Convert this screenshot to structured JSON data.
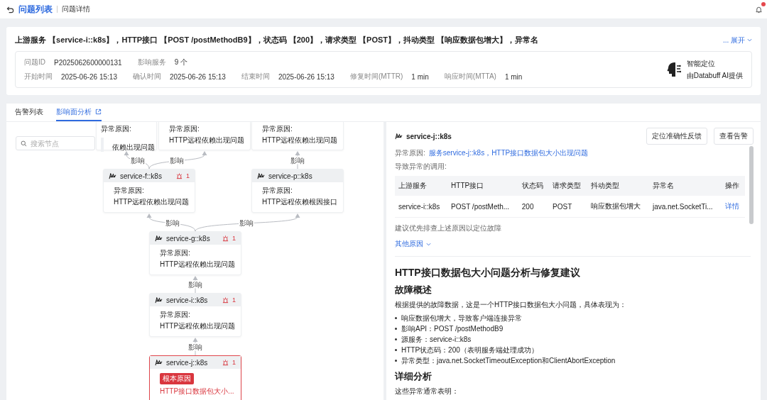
{
  "breadcrumb": {
    "parent": "问题列表",
    "current": "问题详情"
  },
  "notifications": {
    "unread": true
  },
  "issue": {
    "title": "上游服务 【service-i::k8s】，HTTP接口 【POST /postMethodB9】，状态码 【200】，请求类型 【POST】，抖动类型 【响应数据包增大】，异常名",
    "ellipsis": "...",
    "expand": "展开",
    "field_rows": [
      [
        {
          "label": "问题ID",
          "value": "P2025062600000131"
        },
        {
          "label": "影响服务",
          "value": "9 个"
        }
      ],
      [
        {
          "label": "开始时间",
          "value": "2025-06-26 15:13"
        },
        {
          "label": "确认时间",
          "value": "2025-06-26 15:13"
        },
        {
          "label": "结束时间",
          "value": "2025-06-26 15:13"
        },
        {
          "label": "修复时间(MTTR)",
          "value": "1 min"
        },
        {
          "label": "响应时间(MTTA)",
          "value": "1 min"
        }
      ]
    ],
    "ai": {
      "title": "智能定位",
      "subtitle": "由Databuff AI提供"
    }
  },
  "tabs": [
    {
      "label": "告警列表",
      "selected": false,
      "icon": false
    },
    {
      "label": "影响面分析",
      "selected": true,
      "icon": true
    }
  ],
  "graph": {
    "search_placeholder": "搜索节点",
    "nodes": [
      {
        "kind": "covered",
        "reason_label": "异常原因:",
        "reason": "依赖出现问题"
      },
      {
        "kind": "partial",
        "reason_label": "异常原因:",
        "reason": "HTTP远程依赖出现问题"
      },
      {
        "kind": "partial",
        "reason_label": "异常原因:",
        "reason": "HTTP远程依赖出现问题"
      },
      {
        "kind": "service",
        "name": "service-f::k8s",
        "alerts": "1",
        "reason_label": "异常原因:",
        "reason": "HTTP远程依赖出现问题"
      },
      {
        "kind": "service",
        "name": "service-p::k8s",
        "reason_label": "异常原因:",
        "reason": "HTTP远程依赖根因接口"
      },
      {
        "kind": "service",
        "name": "service-g::k8s",
        "alerts": "1",
        "reason_label": "异常原因:",
        "reason": "HTTP远程依赖出现问题"
      },
      {
        "kind": "service",
        "name": "service-i::k8s",
        "alerts": "1",
        "reason_label": "异常原因:",
        "reason": "HTTP远程依赖出现问题"
      },
      {
        "kind": "root",
        "name": "service-j::k8s",
        "alerts": "1",
        "badge": "根本原因",
        "reason": "HTTP接口数据包大小..."
      }
    ],
    "edges": [
      {
        "label": "影响"
      },
      {
        "label": "影响"
      },
      {
        "label": "影响"
      },
      {
        "label": "影响"
      },
      {
        "label": "影响"
      },
      {
        "label": "影响"
      },
      {
        "label": "影响"
      }
    ]
  },
  "detail": {
    "service": "service-j::k8s",
    "buttons": [
      "定位准确性反馈",
      "查看告警"
    ],
    "reason_label": "异常原因:",
    "reason": "服务service-j::k8s，HTTP接口数据包大小出现问题",
    "calls_label": "导致异常的调用:",
    "table": {
      "columns": [
        "上游服务",
        "HTTP接口",
        "状态码",
        "请求类型",
        "抖动类型",
        "异常名",
        "操作"
      ],
      "rows": [
        {
          "cells": [
            "service-i::k8s",
            "POST /postMeth...",
            "200",
            "POST",
            "响应数据包增大",
            "java.net.SocketTi..."
          ],
          "action": "详情"
        }
      ]
    },
    "hint": "建议优先排查上述原因以定位故障",
    "other": "其他原因"
  },
  "report": {
    "title": "HTTP接口数据包大小问题分析与修复建议",
    "sections": [
      {
        "heading": "故障概述",
        "paragraph": "根据提供的故障数据，这是一个HTTP接口数据包大小问题，具体表现为：",
        "bullets": [
          "响应数据包增大，导致客户端连接异常",
          "影响API：POST /postMethodB9",
          "源服务：service-i::k8s",
          "HTTP状态码：200（表明服务端处理成功）",
          "异常类型：java.net.SocketTimeoutException和ClientAbortException"
        ]
      },
      {
        "heading": "详细分析",
        "paragraph": "这些异常通常表明："
      }
    ]
  }
}
